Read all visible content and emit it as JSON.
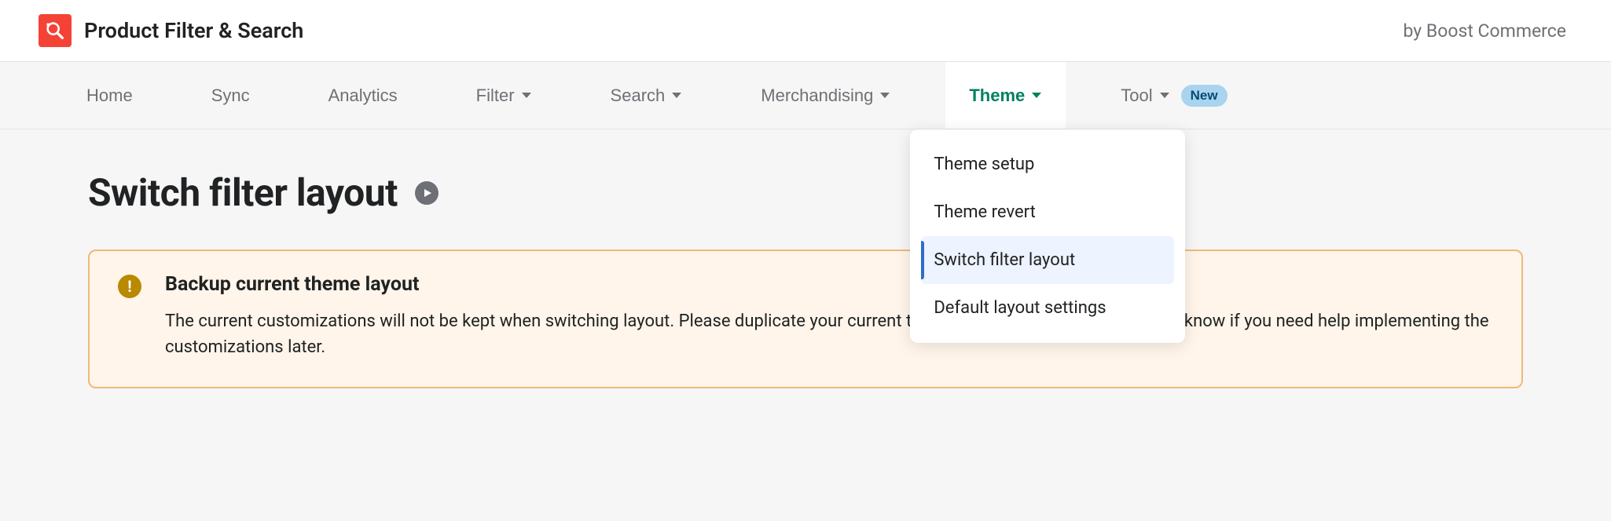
{
  "header": {
    "app_title": "Product Filter & Search",
    "byline": "by Boost Commerce"
  },
  "nav": {
    "home": "Home",
    "sync": "Sync",
    "analytics": "Analytics",
    "filter": "Filter",
    "search": "Search",
    "merchandising": "Merchandising",
    "theme": "Theme",
    "tool": "Tool",
    "tool_badge": "New"
  },
  "theme_menu": {
    "setup": "Theme setup",
    "revert": "Theme revert",
    "switch": "Switch filter layout",
    "defaults": "Default layout settings"
  },
  "page": {
    "title": "Switch filter layout"
  },
  "notice": {
    "title": "Backup current theme layout",
    "body": "The current customizations will not be kept when switching layout. Please duplicate your current theme before switching it and let us know if you need help implementing the customizations later."
  }
}
